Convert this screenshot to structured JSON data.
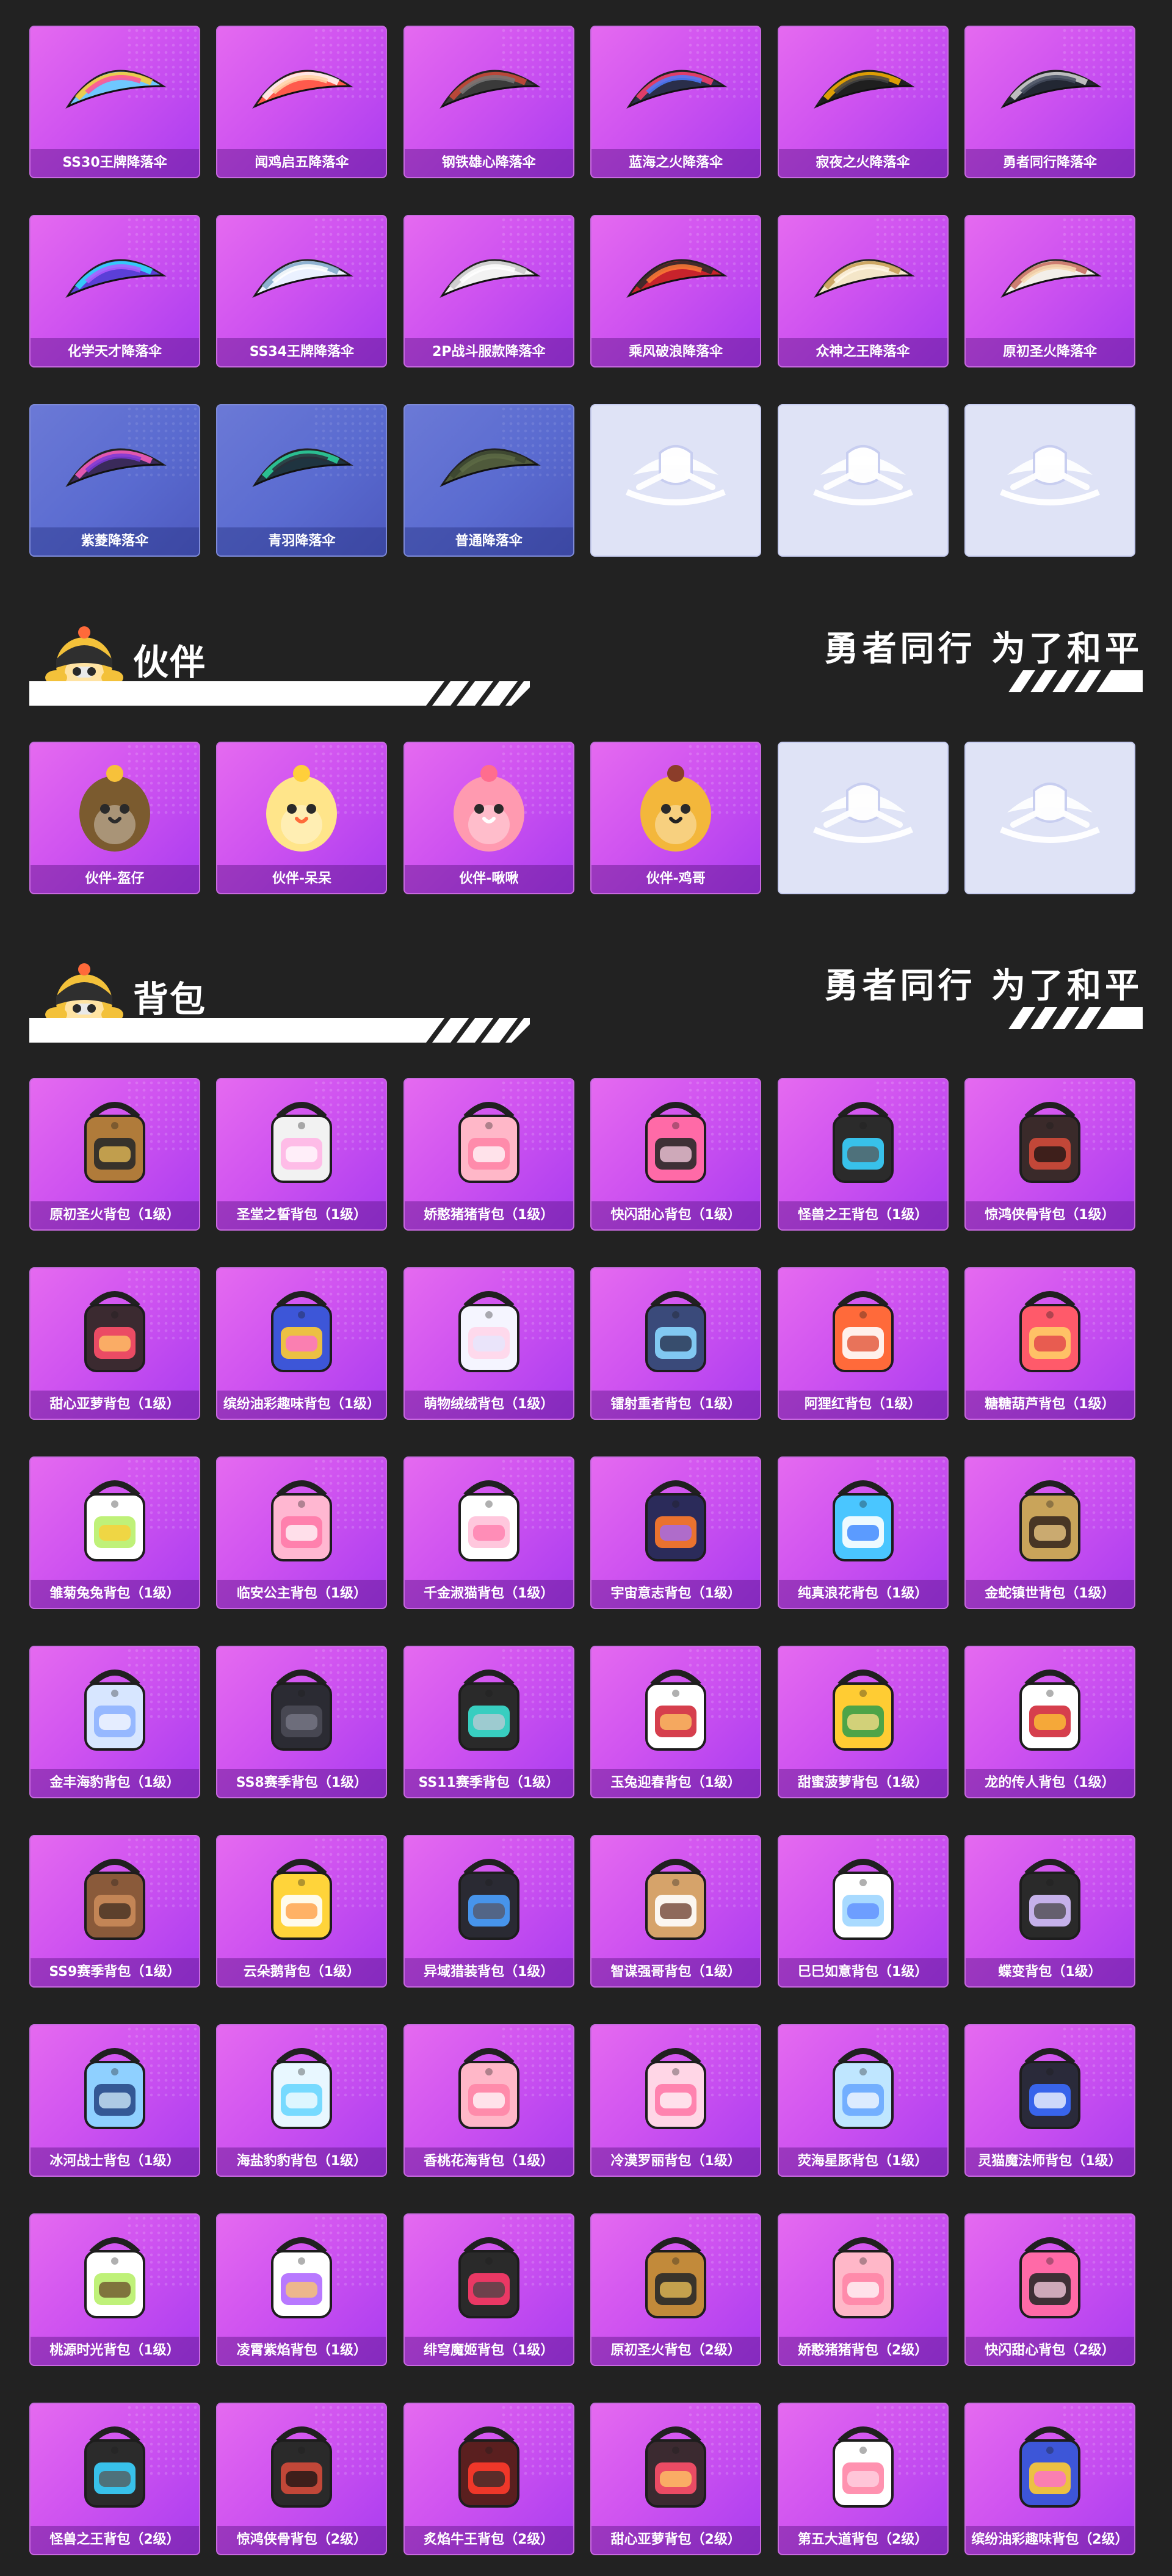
{
  "parachutes": [
    {
      "label": "SS30王牌降落伞",
      "style": "purple",
      "palette": [
        "#6fc7ff",
        "#ffcc33",
        "#ff4f9a"
      ]
    },
    {
      "label": "闻鸡启五降落伞",
      "style": "purple",
      "palette": [
        "#ff5a4c",
        "#ffffff",
        "#ffd2a6"
      ]
    },
    {
      "label": "钢铁雄心降落伞",
      "style": "purple",
      "palette": [
        "#3a3a3a",
        "#d04a3a",
        "#777777"
      ]
    },
    {
      "label": "蓝海之火降落伞",
      "style": "purple",
      "palette": [
        "#2a2e4a",
        "#ff3f6e",
        "#4b7bff"
      ]
    },
    {
      "label": "寂夜之火降落伞",
      "style": "purple",
      "palette": [
        "#1f1f1f",
        "#ffb400",
        "#444444"
      ]
    },
    {
      "label": "勇者同行降落伞",
      "style": "purple",
      "palette": [
        "#222733",
        "#d8d8d8",
        "#444c5e"
      ]
    },
    {
      "label": "化学天才降落伞",
      "style": "purple",
      "palette": [
        "#5b3fd8",
        "#2fe1ff",
        "#b05cff"
      ]
    },
    {
      "label": "SS34王牌降落伞",
      "style": "purple",
      "palette": [
        "#eaf1ff",
        "#7fa7c9",
        "#ffffff"
      ]
    },
    {
      "label": "2P战斗服款降落伞",
      "style": "purple",
      "palette": [
        "#f2f2f2",
        "#c9c9c9",
        "#ffffff"
      ]
    },
    {
      "label": "乘风破浪降落伞",
      "style": "purple",
      "palette": [
        "#c8232c",
        "#2b2b2b",
        "#ff7b36"
      ]
    },
    {
      "label": "众神之王降落伞",
      "style": "purple",
      "palette": [
        "#f4e6c8",
        "#c69b52",
        "#fff7e6"
      ]
    },
    {
      "label": "原初圣火降落伞",
      "style": "purple",
      "palette": [
        "#f3efe9",
        "#c56a5c",
        "#f6d9b0"
      ]
    },
    {
      "label": "紫菱降落伞",
      "style": "blue",
      "palette": [
        "#3a2a5a",
        "#ff5fbf",
        "#7a3ad8"
      ]
    },
    {
      "label": "青羽降落伞",
      "style": "blue",
      "palette": [
        "#1f3440",
        "#2ed7a0",
        "#2a2f3a"
      ]
    },
    {
      "label": "普通降落伞",
      "style": "blue",
      "palette": [
        "#4f5a3b",
        "#3b4530",
        "#5d6b45"
      ]
    },
    {
      "label": "",
      "style": "empty",
      "palette": [
        "#ffffff",
        "#ffffff",
        "#ffffff"
      ]
    },
    {
      "label": "",
      "style": "empty",
      "palette": [
        "#ffffff",
        "#ffffff",
        "#ffffff"
      ]
    },
    {
      "label": "",
      "style": "empty",
      "palette": [
        "#ffffff",
        "#ffffff",
        "#ffffff"
      ]
    }
  ],
  "partner_section": {
    "title": "伙伴",
    "slogan": "勇者同行 为了和平",
    "items": [
      {
        "label": "伙伴-盔仔",
        "style": "purple",
        "palette": [
          "#7b5b2f",
          "#f7c13a",
          "#2b2b2b"
        ]
      },
      {
        "label": "伙伴-呆呆",
        "style": "purple",
        "palette": [
          "#ffe58a",
          "#ffcf3a",
          "#ff6b3a"
        ]
      },
      {
        "label": "伙伴-啾啾",
        "style": "purple",
        "palette": [
          "#ff9ab0",
          "#ff6d8e",
          "#ffffff"
        ]
      },
      {
        "label": "伙伴-鸡哥",
        "style": "purple",
        "palette": [
          "#f3b73b",
          "#8b3d2a",
          "#222222"
        ]
      },
      {
        "label": "",
        "style": "empty",
        "palette": [
          "#ffffff",
          "#ffffff",
          "#ffffff"
        ]
      },
      {
        "label": "",
        "style": "empty",
        "palette": [
          "#ffffff",
          "#ffffff",
          "#ffffff"
        ]
      }
    ]
  },
  "backpack_section": {
    "title": "背包",
    "slogan": "勇者同行 为了和平",
    "items": [
      {
        "label": "原初圣火背包（1级）",
        "style": "purple",
        "palette": [
          "#b07b3a",
          "#2a2a2a",
          "#f0c35a"
        ]
      },
      {
        "label": "圣堂之誓背包（1级）",
        "style": "purple",
        "palette": [
          "#f2f2f2",
          "#ffb6e6",
          "#ffffff"
        ]
      },
      {
        "label": "娇憨猪猪背包（1级）",
        "style": "purple",
        "palette": [
          "#ffb7c8",
          "#ff86a7",
          "#ffffff"
        ]
      },
      {
        "label": "快闪甜心背包（1级）",
        "style": "purple",
        "palette": [
          "#ff6aa7",
          "#2a2a2a",
          "#ffd1e6"
        ]
      },
      {
        "label": "怪兽之王背包（1级）",
        "style": "purple",
        "palette": [
          "#2b2b2b",
          "#3ad1ff",
          "#555555"
        ]
      },
      {
        "label": "惊鸿侠骨背包（1级）",
        "style": "purple",
        "palette": [
          "#3a2a2a",
          "#d14a3a",
          "#111111"
        ]
      },
      {
        "label": "甜心亚萝背包（1级）",
        "style": "purple",
        "palette": [
          "#3b2a30",
          "#ff4f6a",
          "#ffcc66"
        ]
      },
      {
        "label": "缤纷油彩趣味背包（1级）",
        "style": "purple",
        "palette": [
          "#3d56d8",
          "#ffcc33",
          "#ff6ad5"
        ]
      },
      {
        "label": "萌物绒绒背包（1级）",
        "style": "purple",
        "palette": [
          "#f5f5ff",
          "#ffd6ea",
          "#e3e7ff"
        ]
      },
      {
        "label": "镭射重者背包（1级）",
        "style": "purple",
        "palette": [
          "#3a4a7a",
          "#8ad6ff",
          "#1f2440"
        ]
      },
      {
        "label": "阿狸红背包（1级）",
        "style": "purple",
        "palette": [
          "#ff6a3a",
          "#ffffff",
          "#e04a2a"
        ]
      },
      {
        "label": "糖糖葫芦背包（1级）",
        "style": "purple",
        "palette": [
          "#ff5a6a",
          "#ffcc66",
          "#e03a4a"
        ]
      },
      {
        "label": "雏菊兔兔背包（1级）",
        "style": "purple",
        "palette": [
          "#ffffff",
          "#b8f06a",
          "#ffcc33"
        ]
      },
      {
        "label": "临安公主背包（1级）",
        "style": "purple",
        "palette": [
          "#ffb7d1",
          "#ff7aa9",
          "#ffffff"
        ]
      },
      {
        "label": "千金淑猫背包（1级）",
        "style": "purple",
        "palette": [
          "#ffffff",
          "#ffc1d9",
          "#ff7aa9"
        ]
      },
      {
        "label": "宇宙意志背包（1级）",
        "style": "purple",
        "palette": [
          "#2b2b5a",
          "#ff7a2a",
          "#9b6bff"
        ]
      },
      {
        "label": "纯真浪花背包（1级）",
        "style": "purple",
        "palette": [
          "#4ac6ff",
          "#ffffff",
          "#2a7bff"
        ]
      },
      {
        "label": "金蛇镇世背包（1级）",
        "style": "purple",
        "palette": [
          "#c9a45a",
          "#3a2a1f",
          "#f5d18a"
        ]
      },
      {
        "label": "金丰海豹背包（1级）",
        "style": "purple",
        "palette": [
          "#d7e6ff",
          "#8fb2ff",
          "#ffffff"
        ]
      },
      {
        "label": "SS8赛季背包（1级）",
        "style": "purple",
        "palette": [
          "#2b2b33",
          "#4a4a55",
          "#7a7a8a"
        ]
      },
      {
        "label": "SS11赛季背包（1级）",
        "style": "purple",
        "palette": [
          "#2a2a2a",
          "#3ae0d0",
          "#bfc9d6"
        ]
      },
      {
        "label": "玉兔迎春背包（1级）",
        "style": "purple",
        "palette": [
          "#ffffff",
          "#d12a3a",
          "#ffcc66"
        ]
      },
      {
        "label": "甜蜜菠萝背包（1级）",
        "style": "purple",
        "palette": [
          "#ffcc33",
          "#3aa04a",
          "#ffe08a"
        ]
      },
      {
        "label": "龙的传人背包（1级）",
        "style": "purple",
        "palette": [
          "#ffffff",
          "#d12a3a",
          "#ffcc33"
        ]
      },
      {
        "label": "SS9赛季背包（1级）",
        "style": "purple",
        "palette": [
          "#8a5a3a",
          "#c98a5a",
          "#3a2a1f"
        ]
      },
      {
        "label": "云朵鹅背包（1级）",
        "style": "purple",
        "palette": [
          "#ffd43a",
          "#ffffff",
          "#ff9a3a"
        ]
      },
      {
        "label": "异域猎装背包（1级）",
        "style": "purple",
        "palette": [
          "#2a2a33",
          "#4aa0ff",
          "#555566"
        ]
      },
      {
        "label": "智谋强哥背包（1级）",
        "style": "purple",
        "palette": [
          "#d6a36a",
          "#ffffff",
          "#6a3a2a"
        ]
      },
      {
        "label": "巳巳如意背包（1级）",
        "style": "purple",
        "palette": [
          "#ffffff",
          "#9fd6ff",
          "#5a8aff"
        ]
      },
      {
        "label": "蝶变背包（1级）",
        "style": "purple",
        "palette": [
          "#2a2a2a",
          "#d6c0ff",
          "#444444"
        ]
      },
      {
        "label": "冰河战士背包（1级）",
        "style": "purple",
        "palette": [
          "#8fd0ff",
          "#2a4a8a",
          "#d6f0ff"
        ]
      },
      {
        "label": "海盐豹豹背包（1级）",
        "style": "purple",
        "palette": [
          "#e8f7ff",
          "#6ad6ff",
          "#ffffff"
        ]
      },
      {
        "label": "香桃花海背包（1级）",
        "style": "purple",
        "palette": [
          "#ffb7c8",
          "#ff86a7",
          "#ffffff"
        ]
      },
      {
        "label": "冷漠罗丽背包（1级）",
        "style": "purple",
        "palette": [
          "#ffd6e6",
          "#ff7aa9",
          "#ffffff"
        ]
      },
      {
        "label": "荧海星豚背包（1级）",
        "style": "purple",
        "palette": [
          "#bfe6ff",
          "#6aa8ff",
          "#ffffff"
        ]
      },
      {
        "label": "灵猫魔法师背包（1级）",
        "style": "purple",
        "palette": [
          "#2a2a3a",
          "#3a6aff",
          "#ffffff"
        ]
      },
      {
        "label": "桃源时光背包（1级）",
        "style": "purple",
        "palette": [
          "#ffffff",
          "#b8f06a",
          "#6a4a2a"
        ]
      },
      {
        "label": "凌霄紫焰背包（1级）",
        "style": "purple",
        "palette": [
          "#ffffff",
          "#b06aff",
          "#ffcc66"
        ]
      },
      {
        "label": "绯穹魔姬背包（1级）",
        "style": "purple",
        "palette": [
          "#2a2a2a",
          "#ff3a6a",
          "#444444"
        ]
      },
      {
        "label": "原初圣火背包（2级）",
        "style": "purple",
        "palette": [
          "#c28a3a",
          "#2a2a2a",
          "#f3c65a"
        ]
      },
      {
        "label": "娇憨猪猪背包（2级）",
        "style": "purple",
        "palette": [
          "#ffb7c8",
          "#ff86a7",
          "#ffffff"
        ]
      },
      {
        "label": "快闪甜心背包（2级）",
        "style": "purple",
        "palette": [
          "#ff6aa7",
          "#2a2a2a",
          "#ffd1e6"
        ]
      },
      {
        "label": "怪兽之王背包（2级）",
        "style": "purple",
        "palette": [
          "#2b2b2b",
          "#3ad1ff",
          "#555555"
        ]
      },
      {
        "label": "惊鸿侠骨背包（2级）",
        "style": "purple",
        "palette": [
          "#2a2a2a",
          "#d14a3a",
          "#111111"
        ]
      },
      {
        "label": "炙焰牛王背包（2级）",
        "style": "purple",
        "palette": [
          "#5a1f1f",
          "#ff3a2a",
          "#2a2a2a"
        ]
      },
      {
        "label": "甜心亚萝背包（2级）",
        "style": "purple",
        "palette": [
          "#3b2a30",
          "#ff4f6a",
          "#ffcc66"
        ]
      },
      {
        "label": "第五大道背包（2级）",
        "style": "purple",
        "palette": [
          "#ffffff",
          "#ff86a7",
          "#ffd6e6"
        ]
      },
      {
        "label": "缤纷油彩趣味背包（2级）",
        "style": "purple",
        "palette": [
          "#3d56d8",
          "#ffcc33",
          "#ff6ad5"
        ]
      }
    ]
  }
}
